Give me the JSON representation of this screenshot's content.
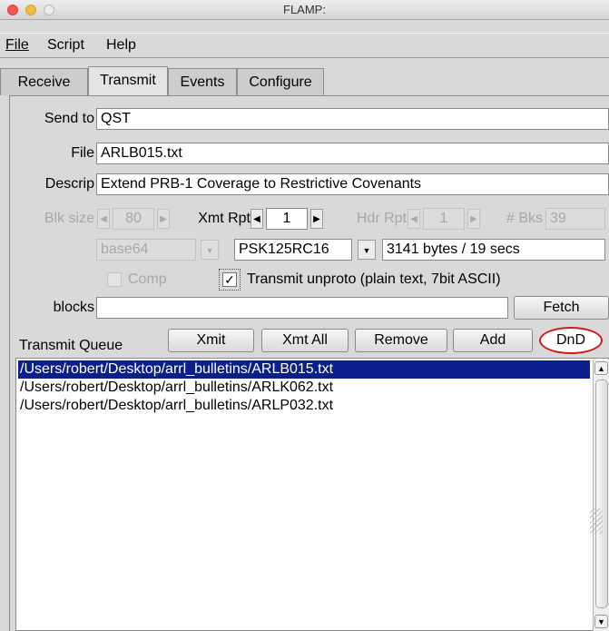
{
  "window": {
    "title": "FLAMP:"
  },
  "menu": {
    "file": "File",
    "script": "Script",
    "help": "Help"
  },
  "tabs": [
    {
      "label": "Receive"
    },
    {
      "label": "Transmit",
      "active": true
    },
    {
      "label": "Events"
    },
    {
      "label": "Configure"
    }
  ],
  "form": {
    "send_to_label": "Send to",
    "send_to_value": "QST",
    "file_label": "File",
    "file_value": "ARLB015.txt",
    "descrip_label": "Descrip",
    "descrip_value": "Extend PRB-1 Coverage to Restrictive Covenants",
    "blk_size_label": "Blk size",
    "blk_size_value": "80",
    "xmt_rpt_label": "Xmt Rpt",
    "xmt_rpt_value": "1",
    "hdr_rpt_label": "Hdr Rpt",
    "hdr_rpt_value": "1",
    "bks_label": "# Bks",
    "bks_value": "39",
    "encoding_value": "base64",
    "mode_value": "PSK125RC16",
    "transfer_info": "3141 bytes / 19 secs",
    "comp_label": "Comp",
    "unproto_label": "Transmit unproto (plain text, 7bit ASCII)",
    "blocks_label": "blocks",
    "blocks_value": "",
    "fetch_label": "Fetch"
  },
  "queue": {
    "label": "Transmit Queue",
    "buttons": {
      "xmit": "Xmit",
      "xmit_all": "Xmt All",
      "remove": "Remove",
      "add": "Add",
      "dnd": "DnD"
    },
    "items": [
      "/Users/robert/Desktop/arrl_bulletins/ARLB015.txt",
      "/Users/robert/Desktop/arrl_bulletins/ARLK062.txt",
      "/Users/robert/Desktop/arrl_bulletins/ARLP032.txt"
    ]
  },
  "colors": {
    "selection": "#0b1f8c",
    "dnd_outline": "#d01a1a"
  }
}
